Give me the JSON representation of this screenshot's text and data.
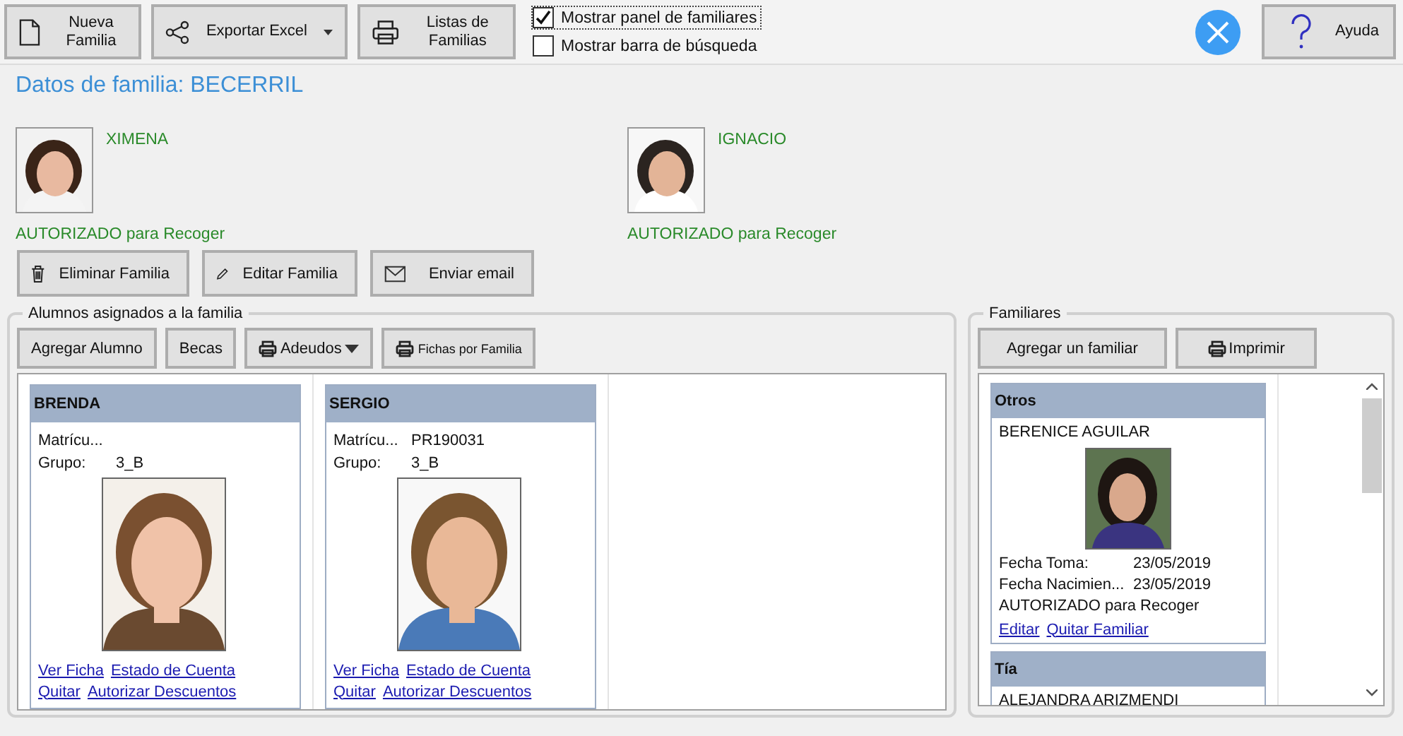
{
  "toolbar": {
    "buttons": [
      {
        "label": "Nueva Familia",
        "kind": "document"
      },
      {
        "label": "Exportar Excel",
        "kind": "share"
      },
      {
        "label": "Listas de Familias",
        "kind": "printer"
      }
    ],
    "checkboxes": [
      {
        "label": "Mostrar panel de familiares",
        "checked": true
      },
      {
        "label": "Mostrar barra de búsqueda",
        "checked": false
      }
    ],
    "help_button": "Ayuda"
  },
  "title": "Datos de familia: BECERRIL",
  "parents": [
    {
      "name": "XIMENA",
      "authorization": "AUTORIZADO para Recoger"
    },
    {
      "name": "IGNACIO",
      "authorization": "AUTORIZADO para Recoger"
    }
  ],
  "family_actions": [
    {
      "label": "Eliminar Familia",
      "kind": "trash"
    },
    {
      "label": "Editar Familia",
      "kind": "pencil"
    },
    {
      "label": "Enviar email",
      "kind": "envelope"
    }
  ],
  "students_panel": {
    "title": "Alumnos asignados a la familia",
    "buttons": [
      {
        "label": "Agregar Alumno",
        "kind": "plain"
      },
      {
        "label": "Becas",
        "kind": "plain"
      },
      {
        "label": "Adeudos",
        "kind": "print_dropdown"
      },
      {
        "label": "Fichas por Familia",
        "kind": "print_small"
      }
    ],
    "students": [
      {
        "name": "BRENDA",
        "fields": [
          {
            "label": "Matrícu..."
          },
          {
            "label": "Grupo:",
            "value": "3_B"
          }
        ],
        "links": [
          [
            "Ver Ficha",
            "Estado de Cuenta"
          ],
          [
            "Quitar",
            "Autorizar Descuentos"
          ]
        ]
      },
      {
        "name": "SERGIO",
        "fields": [
          {
            "label": "Matrícu...",
            "value": "PR190031"
          },
          {
            "label": "Grupo:",
            "value": "3_B"
          }
        ],
        "links": [
          [
            "Ver Ficha",
            "Estado de Cuenta"
          ],
          [
            "Quitar",
            "Autorizar Descuentos"
          ]
        ]
      }
    ]
  },
  "relatives_panel": {
    "title": "Familiares",
    "buttons": [
      {
        "label": "Agregar un familiar",
        "kind": "plain"
      },
      {
        "label": "Imprimir",
        "kind": "print"
      }
    ],
    "relatives": [
      {
        "relation": "Otros",
        "name": "BERENICE AGUILAR",
        "fields": [
          {
            "label": "Fecha Toma:",
            "value": "23/05/2019"
          },
          {
            "label": "Fecha Nacimien...",
            "value": "23/05/2019"
          }
        ],
        "note": "AUTORIZADO para Recoger",
        "links": [
          "Editar",
          "Quitar Familiar"
        ]
      },
      {
        "relation": "Tía",
        "name": "ALEJANDRA ARIZMENDI"
      }
    ]
  }
}
